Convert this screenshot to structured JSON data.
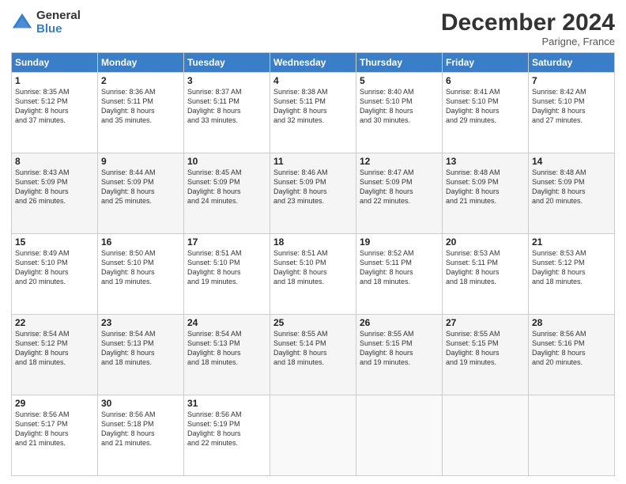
{
  "logo": {
    "general": "General",
    "blue": "Blue"
  },
  "header": {
    "month": "December 2024",
    "location": "Parigne, France"
  },
  "weekdays": [
    "Sunday",
    "Monday",
    "Tuesday",
    "Wednesday",
    "Thursday",
    "Friday",
    "Saturday"
  ],
  "weeks": [
    [
      {
        "day": "1",
        "lines": [
          "Sunrise: 8:35 AM",
          "Sunset: 5:12 PM",
          "Daylight: 8 hours",
          "and 37 minutes."
        ]
      },
      {
        "day": "2",
        "lines": [
          "Sunrise: 8:36 AM",
          "Sunset: 5:11 PM",
          "Daylight: 8 hours",
          "and 35 minutes."
        ]
      },
      {
        "day": "3",
        "lines": [
          "Sunrise: 8:37 AM",
          "Sunset: 5:11 PM",
          "Daylight: 8 hours",
          "and 33 minutes."
        ]
      },
      {
        "day": "4",
        "lines": [
          "Sunrise: 8:38 AM",
          "Sunset: 5:11 PM",
          "Daylight: 8 hours",
          "and 32 minutes."
        ]
      },
      {
        "day": "5",
        "lines": [
          "Sunrise: 8:40 AM",
          "Sunset: 5:10 PM",
          "Daylight: 8 hours",
          "and 30 minutes."
        ]
      },
      {
        "day": "6",
        "lines": [
          "Sunrise: 8:41 AM",
          "Sunset: 5:10 PM",
          "Daylight: 8 hours",
          "and 29 minutes."
        ]
      },
      {
        "day": "7",
        "lines": [
          "Sunrise: 8:42 AM",
          "Sunset: 5:10 PM",
          "Daylight: 8 hours",
          "and 27 minutes."
        ]
      }
    ],
    [
      {
        "day": "8",
        "lines": [
          "Sunrise: 8:43 AM",
          "Sunset: 5:09 PM",
          "Daylight: 8 hours",
          "and 26 minutes."
        ]
      },
      {
        "day": "9",
        "lines": [
          "Sunrise: 8:44 AM",
          "Sunset: 5:09 PM",
          "Daylight: 8 hours",
          "and 25 minutes."
        ]
      },
      {
        "day": "10",
        "lines": [
          "Sunrise: 8:45 AM",
          "Sunset: 5:09 PM",
          "Daylight: 8 hours",
          "and 24 minutes."
        ]
      },
      {
        "day": "11",
        "lines": [
          "Sunrise: 8:46 AM",
          "Sunset: 5:09 PM",
          "Daylight: 8 hours",
          "and 23 minutes."
        ]
      },
      {
        "day": "12",
        "lines": [
          "Sunrise: 8:47 AM",
          "Sunset: 5:09 PM",
          "Daylight: 8 hours",
          "and 22 minutes."
        ]
      },
      {
        "day": "13",
        "lines": [
          "Sunrise: 8:48 AM",
          "Sunset: 5:09 PM",
          "Daylight: 8 hours",
          "and 21 minutes."
        ]
      },
      {
        "day": "14",
        "lines": [
          "Sunrise: 8:48 AM",
          "Sunset: 5:09 PM",
          "Daylight: 8 hours",
          "and 20 minutes."
        ]
      }
    ],
    [
      {
        "day": "15",
        "lines": [
          "Sunrise: 8:49 AM",
          "Sunset: 5:10 PM",
          "Daylight: 8 hours",
          "and 20 minutes."
        ]
      },
      {
        "day": "16",
        "lines": [
          "Sunrise: 8:50 AM",
          "Sunset: 5:10 PM",
          "Daylight: 8 hours",
          "and 19 minutes."
        ]
      },
      {
        "day": "17",
        "lines": [
          "Sunrise: 8:51 AM",
          "Sunset: 5:10 PM",
          "Daylight: 8 hours",
          "and 19 minutes."
        ]
      },
      {
        "day": "18",
        "lines": [
          "Sunrise: 8:51 AM",
          "Sunset: 5:10 PM",
          "Daylight: 8 hours",
          "and 18 minutes."
        ]
      },
      {
        "day": "19",
        "lines": [
          "Sunrise: 8:52 AM",
          "Sunset: 5:11 PM",
          "Daylight: 8 hours",
          "and 18 minutes."
        ]
      },
      {
        "day": "20",
        "lines": [
          "Sunrise: 8:53 AM",
          "Sunset: 5:11 PM",
          "Daylight: 8 hours",
          "and 18 minutes."
        ]
      },
      {
        "day": "21",
        "lines": [
          "Sunrise: 8:53 AM",
          "Sunset: 5:12 PM",
          "Daylight: 8 hours",
          "and 18 minutes."
        ]
      }
    ],
    [
      {
        "day": "22",
        "lines": [
          "Sunrise: 8:54 AM",
          "Sunset: 5:12 PM",
          "Daylight: 8 hours",
          "and 18 minutes."
        ]
      },
      {
        "day": "23",
        "lines": [
          "Sunrise: 8:54 AM",
          "Sunset: 5:13 PM",
          "Daylight: 8 hours",
          "and 18 minutes."
        ]
      },
      {
        "day": "24",
        "lines": [
          "Sunrise: 8:54 AM",
          "Sunset: 5:13 PM",
          "Daylight: 8 hours",
          "and 18 minutes."
        ]
      },
      {
        "day": "25",
        "lines": [
          "Sunrise: 8:55 AM",
          "Sunset: 5:14 PM",
          "Daylight: 8 hours",
          "and 18 minutes."
        ]
      },
      {
        "day": "26",
        "lines": [
          "Sunrise: 8:55 AM",
          "Sunset: 5:15 PM",
          "Daylight: 8 hours",
          "and 19 minutes."
        ]
      },
      {
        "day": "27",
        "lines": [
          "Sunrise: 8:55 AM",
          "Sunset: 5:15 PM",
          "Daylight: 8 hours",
          "and 19 minutes."
        ]
      },
      {
        "day": "28",
        "lines": [
          "Sunrise: 8:56 AM",
          "Sunset: 5:16 PM",
          "Daylight: 8 hours",
          "and 20 minutes."
        ]
      }
    ],
    [
      {
        "day": "29",
        "lines": [
          "Sunrise: 8:56 AM",
          "Sunset: 5:17 PM",
          "Daylight: 8 hours",
          "and 21 minutes."
        ]
      },
      {
        "day": "30",
        "lines": [
          "Sunrise: 8:56 AM",
          "Sunset: 5:18 PM",
          "Daylight: 8 hours",
          "and 21 minutes."
        ]
      },
      {
        "day": "31",
        "lines": [
          "Sunrise: 8:56 AM",
          "Sunset: 5:19 PM",
          "Daylight: 8 hours",
          "and 22 minutes."
        ]
      },
      null,
      null,
      null,
      null
    ]
  ]
}
